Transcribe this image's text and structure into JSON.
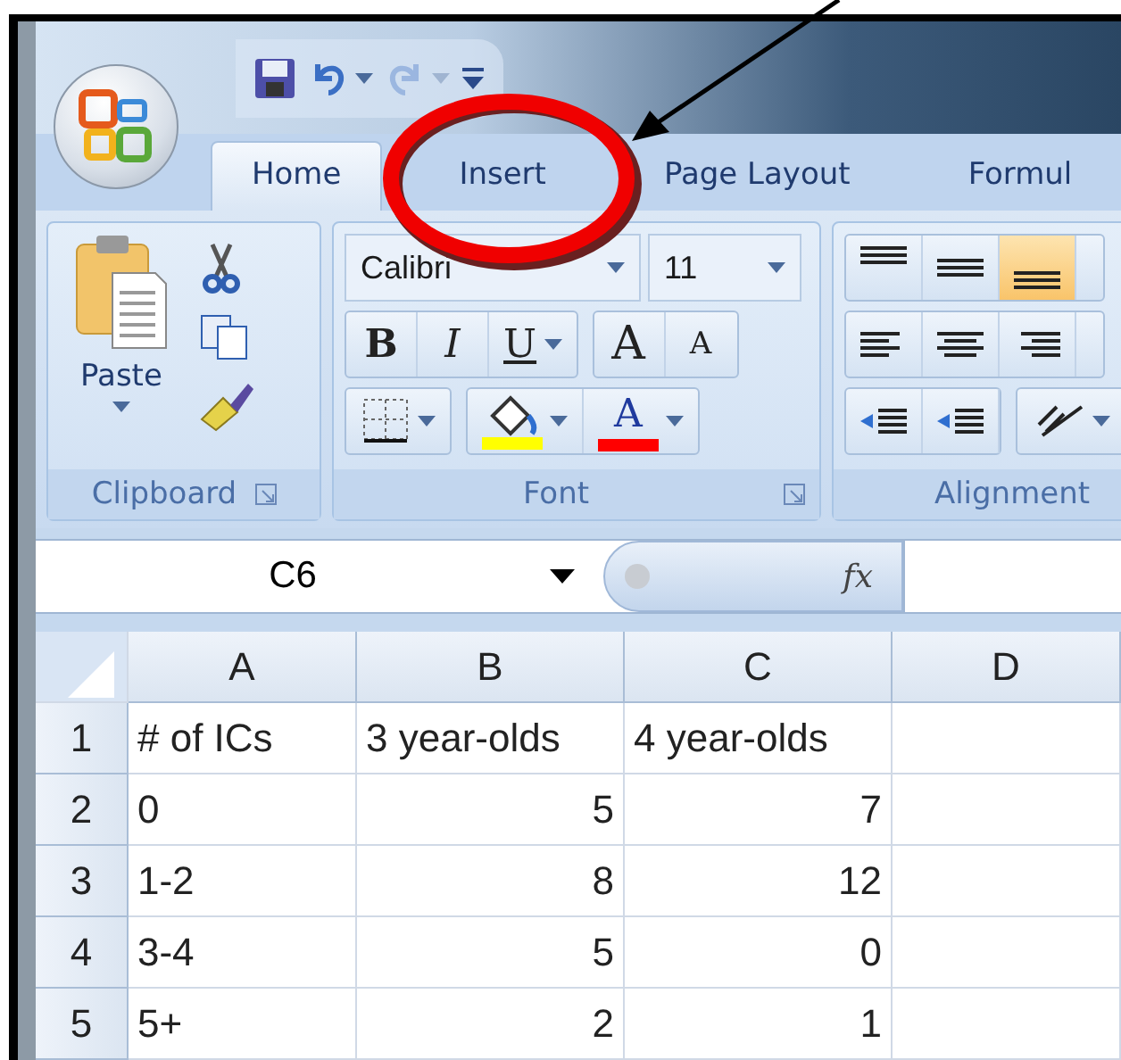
{
  "quick_access": [
    {
      "kind": "save",
      "disabled": false
    },
    {
      "kind": "undo",
      "disabled": false
    },
    {
      "kind": "redo",
      "disabled": true
    },
    {
      "kind": "customize",
      "disabled": false
    }
  ],
  "tabs": [
    {
      "label": "Home",
      "selected": true
    },
    {
      "label": "Insert",
      "selected": false
    },
    {
      "label": "Page Layout",
      "selected": false
    },
    {
      "label": "Formul",
      "selected": false
    }
  ],
  "ribbon": {
    "clipboard": {
      "label": "Clipboard",
      "paste": "Paste"
    },
    "font": {
      "label": "Font",
      "font_name": "Calibri",
      "font_size": "11",
      "bold": "B",
      "italic": "I",
      "underline": "U",
      "grow": "A",
      "shrink": "A",
      "font_color": "A"
    },
    "alignment": {
      "label": "Alignment",
      "vertical": [
        {
          "selected": false
        },
        {
          "selected": false
        },
        {
          "selected": true
        }
      ]
    }
  },
  "formula_bar": {
    "name_box": "C6",
    "function_label": "fx"
  },
  "sheet": {
    "columns": [
      "A",
      "B",
      "C",
      "D"
    ],
    "rows": [
      {
        "number": "1",
        "cells": [
          {
            "text": "# of ICs",
            "kind": "text"
          },
          {
            "text": "3 year-olds",
            "kind": "text"
          },
          {
            "text": "4 year-olds",
            "kind": "text"
          }
        ]
      },
      {
        "number": "2",
        "cells": [
          {
            "text": "0",
            "kind": "text"
          },
          {
            "text": "5",
            "kind": "number"
          },
          {
            "text": "7",
            "kind": "number"
          }
        ]
      },
      {
        "number": "3",
        "cells": [
          {
            "text": "1-2",
            "kind": "text"
          },
          {
            "text": "8",
            "kind": "number"
          },
          {
            "text": "12",
            "kind": "number"
          }
        ]
      },
      {
        "number": "4",
        "cells": [
          {
            "text": "3-4",
            "kind": "text"
          },
          {
            "text": "5",
            "kind": "number"
          },
          {
            "text": "0",
            "kind": "number"
          }
        ]
      },
      {
        "number": "5",
        "cells": [
          {
            "text": "5+",
            "kind": "text"
          },
          {
            "text": "2",
            "kind": "number"
          },
          {
            "text": "1",
            "kind": "number"
          }
        ]
      }
    ]
  }
}
